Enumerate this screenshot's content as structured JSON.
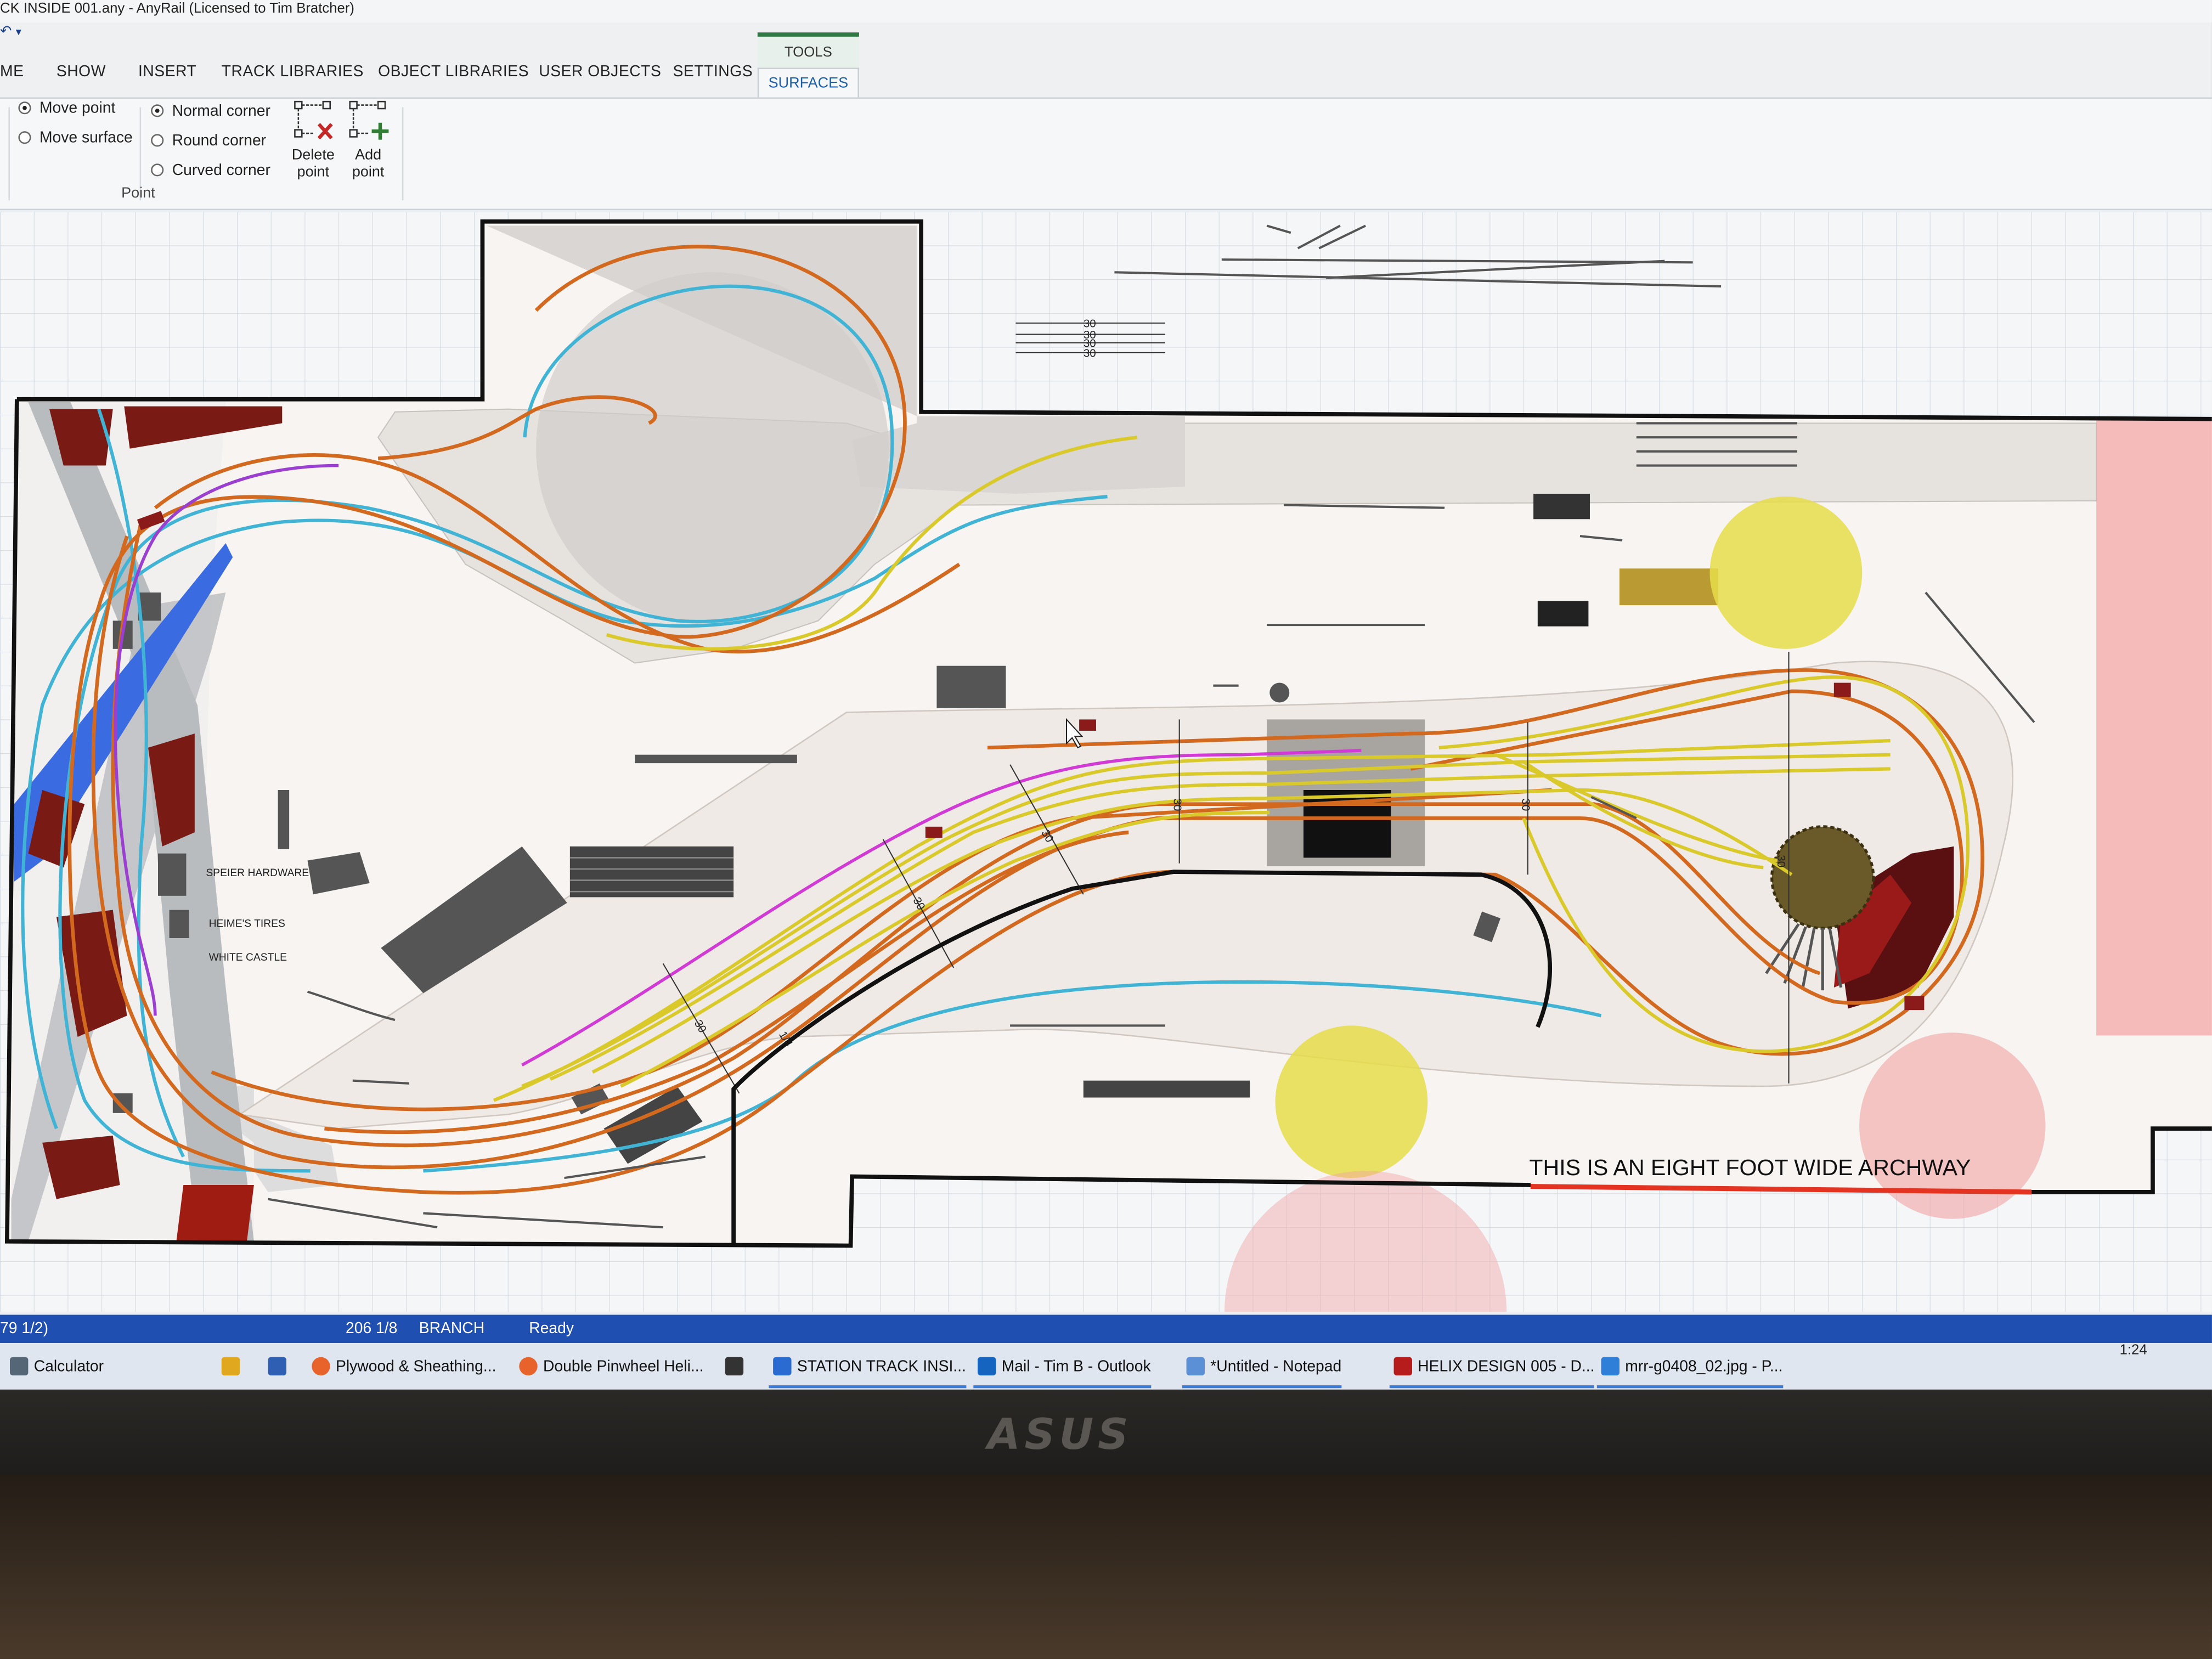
{
  "window": {
    "title": "CK INSIDE 001.any - AnyRail (Licensed to Tim Bratcher)"
  },
  "tabs": [
    {
      "label": "ME"
    },
    {
      "label": "SHOW"
    },
    {
      "label": "INSERT"
    },
    {
      "label": "TRACK LIBRARIES"
    },
    {
      "label": "OBJECT LIBRARIES"
    },
    {
      "label": "USER OBJECTS"
    },
    {
      "label": "SETTINGS"
    }
  ],
  "tools_group": {
    "label": "TOOLS",
    "active_tab": "SURFACES"
  },
  "ribbon": {
    "move_options": [
      {
        "label": "Move point",
        "selected": true
      },
      {
        "label": "Move surface",
        "selected": false
      }
    ],
    "corner_options": [
      {
        "label": "Normal corner",
        "selected": true
      },
      {
        "label": "Round corner",
        "selected": false
      },
      {
        "label": "Curved corner",
        "selected": false
      }
    ],
    "delete_point": {
      "line1": "Delete",
      "line2": "point"
    },
    "add_point": {
      "line1": "Add",
      "line2": "point"
    },
    "group_label": "Point"
  },
  "canvas": {
    "labels": {
      "speier": "SPEIER HARDWARE",
      "heimes": "HEIME'S TIRES",
      "castle": "WHITE CASTLE",
      "archway": "THIS IS AN EIGHT FOOT WIDE ARCHWAY"
    },
    "dims": [
      "30",
      "30",
      "30",
      "30",
      "30",
      "30",
      "30",
      "30",
      "30",
      "30",
      "1/4"
    ]
  },
  "statusbar": {
    "coord": "79 1/2)",
    "coord2": "206 1/8",
    "layer": "BRANCH",
    "state": "Ready"
  },
  "taskbar": {
    "items": [
      {
        "label": "Calculator",
        "icon": "calculator-icon",
        "color": "#556677"
      },
      {
        "label": "Plywood & Sheathing...",
        "icon": "firefox-icon",
        "color": "#e8632b"
      },
      {
        "label": "Double Pinwheel Heli...",
        "icon": "firefox-icon",
        "color": "#e8632b"
      },
      {
        "label": "STATION TRACK INSI...",
        "icon": "anyrail-icon",
        "color": "#2a6bd1"
      },
      {
        "label": "Mail - Tim B - Outlook",
        "icon": "outlook-icon",
        "color": "#1565c0"
      },
      {
        "label": "*Untitled - Notepad",
        "icon": "notepad-icon",
        "color": "#5b8fd6"
      },
      {
        "label": "HELIX DESIGN 005 - D...",
        "icon": "sketchup-icon",
        "color": "#b71c1c"
      },
      {
        "label": "mrr-g0408_02.jpg - P...",
        "icon": "paint-icon",
        "color": "#2f7fd8"
      }
    ],
    "clock": "1:24"
  },
  "monitor": {
    "brand": "ASUS"
  }
}
